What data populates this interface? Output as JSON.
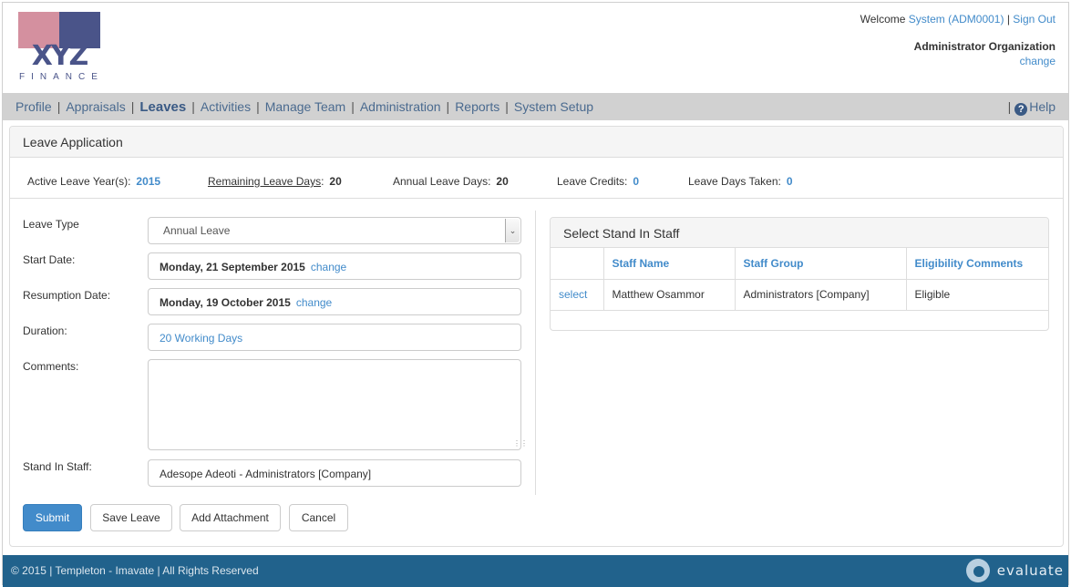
{
  "header": {
    "logo": {
      "mark": "XYZ",
      "tagline": "FINANCE",
      "colors": {
        "pink": "#d4909f",
        "navy": "#4a5489"
      }
    },
    "welcome_prefix": "Welcome",
    "user_link": "System (ADM0001)",
    "separator": "|",
    "sign_out": "Sign Out",
    "organization": "Administrator Organization",
    "org_change": "change"
  },
  "nav": {
    "items": [
      {
        "label": "Profile",
        "active": false
      },
      {
        "label": "Appraisals",
        "active": false
      },
      {
        "label": "Leaves",
        "active": true
      },
      {
        "label": "Activities",
        "active": false
      },
      {
        "label": "Manage Team",
        "active": false
      },
      {
        "label": "Administration",
        "active": false
      },
      {
        "label": "Reports",
        "active": false
      },
      {
        "label": "System Setup",
        "active": false
      }
    ],
    "separator": "|",
    "help_icon": "question-circle-icon",
    "help_glyph": "?",
    "help_label": "Help"
  },
  "panel": {
    "title": "Leave Application",
    "stats": {
      "active_year_label": "Active Leave Year(s):",
      "active_year_value": "2015",
      "remaining_label": "Remaining Leave Days",
      "remaining_suffix": ":",
      "remaining_value": "20",
      "annual_label": "Annual Leave Days:",
      "annual_value": "20",
      "credits_label": "Leave Credits:",
      "credits_value": "0",
      "taken_label": "Leave Days Taken:",
      "taken_value": "0"
    },
    "form": {
      "leave_type_label": "Leave Type",
      "leave_type_value": "Annual Leave",
      "start_date_label": "Start Date:",
      "start_date_value": "Monday, 21 September 2015",
      "start_date_change": "change",
      "resumption_label": "Resumption Date:",
      "resumption_value": "Monday, 19 October 2015",
      "resumption_change": "change",
      "duration_label": "Duration:",
      "duration_value": "20 Working Days",
      "comments_label": "Comments:",
      "comments_value": "",
      "stand_in_label": "Stand In Staff:",
      "stand_in_value": "Adesope Adeoti - Administrators [Company]"
    },
    "buttons": {
      "submit": "Submit",
      "save": "Save Leave",
      "attach": "Add Attachment",
      "cancel": "Cancel"
    },
    "stand_in_panel": {
      "title": "Select Stand In Staff",
      "columns": [
        "",
        "Staff Name",
        "Staff Group",
        "Eligibility Comments"
      ],
      "rows": [
        {
          "action": "select",
          "name": "Matthew Osammor",
          "group": "Administrators [Company]",
          "eligibility": "Eligible"
        }
      ]
    }
  },
  "footer": {
    "copyright": "© 2015 | Templeton - Imavate | All Rights Reserved",
    "brand": "evaluate",
    "colors": {
      "background": "#21628c"
    }
  },
  "theme": {
    "accent": "#428bca",
    "nav_bg": "#d1d1d1"
  }
}
